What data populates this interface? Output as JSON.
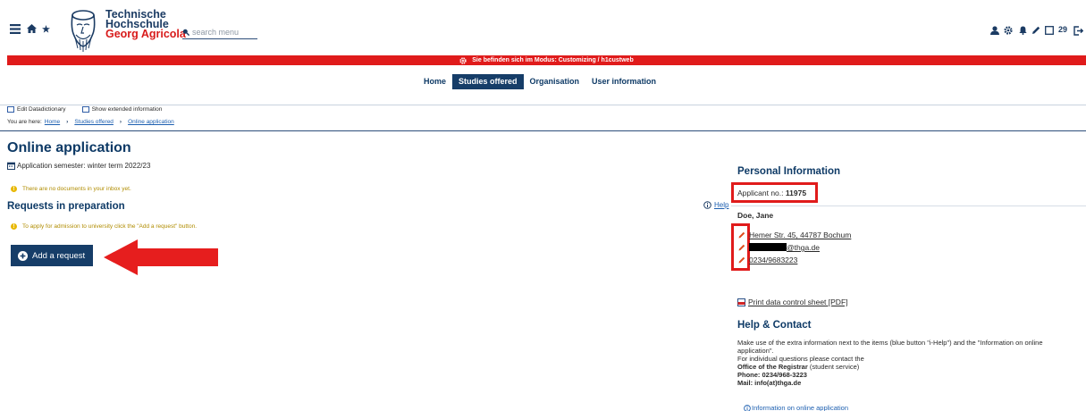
{
  "header": {
    "brand_line1": "Technische",
    "brand_line2": "Hochschule",
    "brand_line3": "Georg Agricola",
    "search_placeholder": "search menu",
    "counter": "29"
  },
  "mode_bar": {
    "text": "Sie befinden sich im Modus: Customizing / h1custweb",
    "color": "#e01b1b"
  },
  "nav": {
    "items": [
      {
        "label": "Home",
        "active": false
      },
      {
        "label": "Studies offered",
        "active": true
      },
      {
        "label": "Organisation",
        "active": false
      },
      {
        "label": "User information",
        "active": false
      }
    ]
  },
  "options": {
    "edit_dd": "Edit Datadictionary",
    "extended": "Show extended information"
  },
  "breadcrumb": {
    "prefix": "You are here:",
    "items": [
      "Home",
      "Studies offered",
      "Online application"
    ]
  },
  "main": {
    "title": "Online application",
    "semester": "Application semester: winter term 2022/23",
    "inbox_note": "There are no documents in your inbox yet.",
    "requests_heading": "Requests in preparation",
    "requests_note": "To apply for admission to university click the \"Add a request\" button.",
    "add_request": "Add a request",
    "help_label": "Help"
  },
  "personal": {
    "heading": "Personal Information",
    "applicant_label": "Applicant no.:",
    "applicant_no": "11975",
    "name": "Doe, Jane",
    "address": "Hemer Str. 45, 44787 Bochum",
    "email_suffix": "@thga.de",
    "phone": "0234/9683223",
    "print_sheet": "Print data control sheet [PDF]"
  },
  "help_contact": {
    "heading": "Help & Contact",
    "line1": "Make use of the extra information next to the items (blue button \"i-Help\") and the \"Information on online",
    "line2": "application\".",
    "line3": "For individual questions please contact the",
    "office_bold": "Office of the Registrar",
    "office_rest": " (student service)",
    "phone": "Phone: 0234/968-3223",
    "mail": "Mail: info(at)thga.de",
    "info_link": "Information on online application"
  },
  "colors": {
    "navy": "#163d68",
    "accent_red": "#e01b1b",
    "warning": "#e8b800",
    "link": "#1d5fb0"
  }
}
